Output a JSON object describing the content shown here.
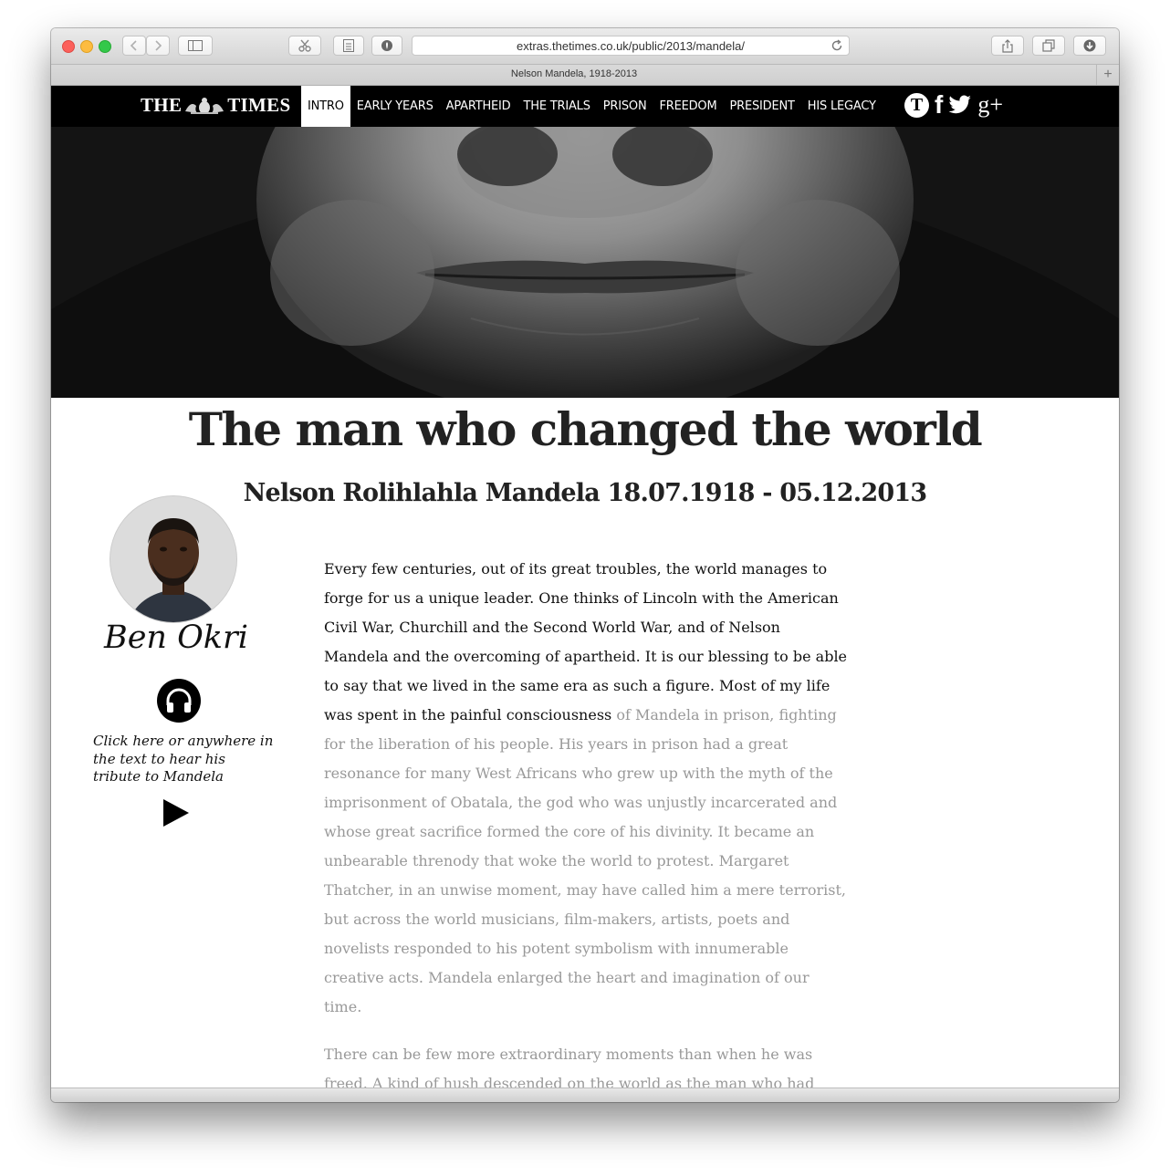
{
  "browser": {
    "url": "extras.thetimes.co.uk/public/2013/mandela/",
    "tab_title": "Nelson Mandela, 1918-2013",
    "new_tab_label": "+"
  },
  "site": {
    "masthead_left": "THE",
    "masthead_right": "TIMES",
    "nav": [
      "INTRO",
      "EARLY YEARS",
      "APARTHEID",
      "THE TRIALS",
      "PRISON",
      "FREEDOM",
      "PRESIDENT",
      "HIS LEGACY"
    ],
    "active_nav": "INTRO",
    "social_icons": [
      "times-t-icon",
      "facebook-icon",
      "twitter-icon",
      "google-plus-icon"
    ],
    "t_logo_text": "T",
    "fb_text": "f",
    "gplus_text": "g+"
  },
  "article": {
    "headline": "The man who changed the world",
    "subhead": "Nelson Rolihlahla Mandela 18.07.1918 - 05.12.2013",
    "author": "Ben Okri",
    "audio_hint": "Click here or anywhere in the text to hear his tribute to Mandela",
    "p1_read": "Every few centuries, out of its great troubles, the world manages to forge for us a unique leader. One thinks of Lincoln with the American Civil War, Churchill and the Second World War, and of Nelson Mandela and the overcoming of apartheid. It is our blessing to be able to say that we lived in the same era as such a figure. Most of my life was spent in the painful consciousness",
    "p1_unread": " of Mandela in prison, fighting for the liberation of his people. His years in prison had a great resonance for many West Africans who grew up with the myth of the imprisonment of Obatala, the god who was unjustly incarcerated and whose great sacrifice formed the core of his divinity. It became an unbearable threnody that woke the world to protest. Margaret Thatcher, in an unwise moment, may have called him a mere terrorist, but across the world musicians, film-makers, artists, poets and novelists responded to his potent symbolism with innumerable creative acts. Mandela enlarged the heart and imagination of our time.",
    "p2": "There can be few more extraordinary moments than when he was freed. A kind of hush descended on the world as the man who had been a myth became again a man. It was a poignant moment, distilled of tears,"
  },
  "colors": {
    "nav_bg": "#000000",
    "read_text": "#111111",
    "unread_text": "#999999"
  }
}
